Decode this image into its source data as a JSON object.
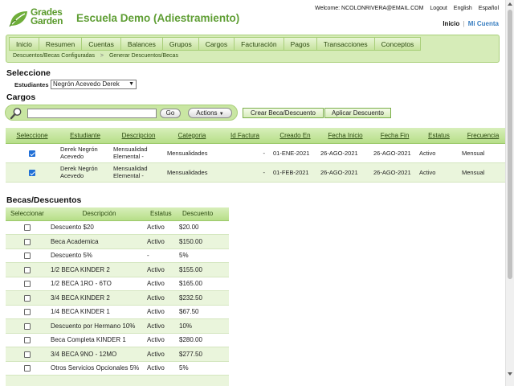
{
  "header": {
    "logo_line1": "Grades",
    "logo_line2": "Garden",
    "school_title": "Escuela Demo (Adiestramiento)",
    "welcome": "Welcome: NCOLONRIVERA@EMAIL.COM",
    "logout": "Logout",
    "english": "English",
    "espanol": "Español",
    "inicio": "Inicio",
    "separator": "|",
    "mi_cuenta": "Mi Cuenta"
  },
  "nav": {
    "items": [
      "Inicio",
      "Resumen",
      "Cuentas",
      "Balances",
      "Grupos",
      "Cargos",
      "Facturación",
      "Pagos",
      "Transacciones",
      "Conceptos"
    ],
    "breadcrumb": [
      "Descuentos/Becas Configuradas",
      "Generar Descuentos/Becas"
    ],
    "breadcrumb_arrow": ">"
  },
  "seleccione": {
    "heading": "Seleccione",
    "estudiantes_label": "Estudiantes",
    "estudiante_selected": "Negrón Acevedo Derek"
  },
  "cargos": {
    "heading": "Cargos",
    "search_value": "",
    "go_label": "Go",
    "actions_label": "Actions",
    "crear_label": "Crear Beca/Descuento",
    "aplicar_label": "Aplicar Descuento",
    "columns": [
      "Seleccione",
      "Estudiante",
      "Descripcion",
      "Categoria",
      "Id Factura",
      "Creado En",
      "Fecha Inicio",
      "Fecha Fin",
      "Estatus",
      "Frecuencia"
    ],
    "rows": [
      {
        "checked": true,
        "estudiante": "Derek Negrón Acevedo",
        "descripcion": "Mensualidad Elemental -",
        "categoria": "Mensualidades",
        "id_factura": "-",
        "creado_en": "01-ENE-2021",
        "fecha_inicio": "26-AGO-2021",
        "fecha_fin": "26-AGO-2021",
        "estatus": "Activo",
        "frecuencia": "Mensual"
      },
      {
        "checked": true,
        "estudiante": "Derek Negrón Acevedo",
        "descripcion": "Mensualidad Elemental -",
        "categoria": "Mensualidades",
        "id_factura": "-",
        "creado_en": "01-FEB-2021",
        "fecha_inicio": "26-AGO-2021",
        "fecha_fin": "26-AGO-2021",
        "estatus": "Activo",
        "frecuencia": "Mensual"
      }
    ]
  },
  "becas": {
    "heading": "Becas/Descuentos",
    "columns": [
      "Seleccionar",
      "Descripción",
      "Estatus",
      "Descuento"
    ],
    "rows": [
      {
        "descripcion": "Descuento $20",
        "estatus": "Activo",
        "descuento": "$20.00"
      },
      {
        "descripcion": "Beca Academica",
        "estatus": "Activo",
        "descuento": "$150.00"
      },
      {
        "descripcion": "Descuento 5%",
        "estatus": "-",
        "descuento": "5%"
      },
      {
        "descripcion": "1/2 BECA KINDER 2",
        "estatus": "Activo",
        "descuento": "$155.00"
      },
      {
        "descripcion": "1/2 BECA 1RO - 6TO",
        "estatus": "Activo",
        "descuento": "$165.00"
      },
      {
        "descripcion": "3/4 BECA KINDER 2",
        "estatus": "Activo",
        "descuento": "$232.50"
      },
      {
        "descripcion": "1/4 BECA KINDER 1",
        "estatus": "Activo",
        "descuento": "$67.50"
      },
      {
        "descripcion": "Descuento por Hermano 10%",
        "estatus": "Activo",
        "descuento": "10%"
      },
      {
        "descripcion": "Beca Completa KINDER 1",
        "estatus": "Activo",
        "descuento": "$280.00"
      },
      {
        "descripcion": "3/4 BECA 9NO - 12MO",
        "estatus": "Activo",
        "descuento": "$277.50"
      },
      {
        "descripcion": "Otros Servicios Opcionales 5%",
        "estatus": "Activo",
        "descuento": "5%"
      },
      {
        "descripcion": "",
        "estatus": "",
        "descuento": ""
      }
    ]
  },
  "colors": {
    "brand_green": "#5f9e34",
    "nav_bg": "#d6ecb8",
    "header_green": "#b6de88",
    "link_blue": "#3a7fc1",
    "checkbox_blue": "#1f6fd6"
  }
}
